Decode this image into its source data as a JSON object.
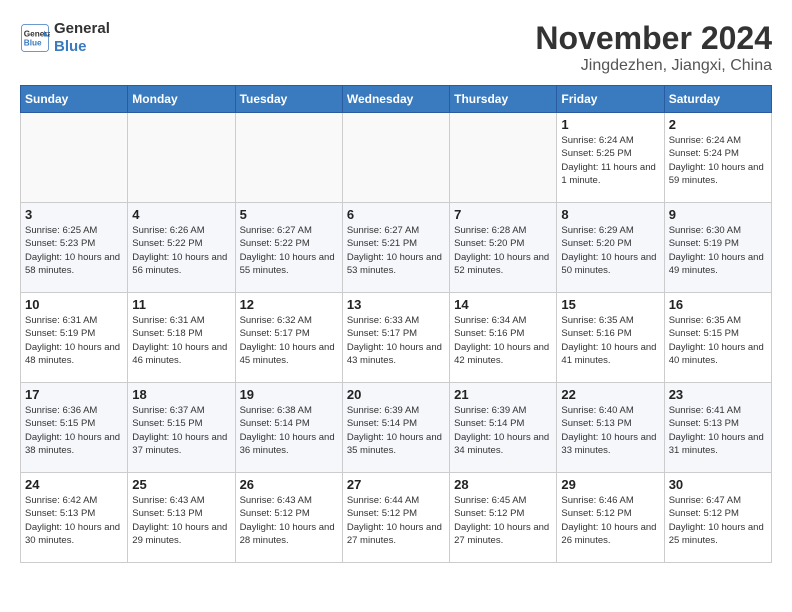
{
  "logo": {
    "line1": "General",
    "line2": "Blue"
  },
  "title": "November 2024",
  "subtitle": "Jingdezhen, Jiangxi, China",
  "headers": [
    "Sunday",
    "Monday",
    "Tuesday",
    "Wednesday",
    "Thursday",
    "Friday",
    "Saturday"
  ],
  "weeks": [
    [
      {
        "day": "",
        "info": ""
      },
      {
        "day": "",
        "info": ""
      },
      {
        "day": "",
        "info": ""
      },
      {
        "day": "",
        "info": ""
      },
      {
        "day": "",
        "info": ""
      },
      {
        "day": "1",
        "info": "Sunrise: 6:24 AM\nSunset: 5:25 PM\nDaylight: 11 hours and 1 minute."
      },
      {
        "day": "2",
        "info": "Sunrise: 6:24 AM\nSunset: 5:24 PM\nDaylight: 10 hours and 59 minutes."
      }
    ],
    [
      {
        "day": "3",
        "info": "Sunrise: 6:25 AM\nSunset: 5:23 PM\nDaylight: 10 hours and 58 minutes."
      },
      {
        "day": "4",
        "info": "Sunrise: 6:26 AM\nSunset: 5:22 PM\nDaylight: 10 hours and 56 minutes."
      },
      {
        "day": "5",
        "info": "Sunrise: 6:27 AM\nSunset: 5:22 PM\nDaylight: 10 hours and 55 minutes."
      },
      {
        "day": "6",
        "info": "Sunrise: 6:27 AM\nSunset: 5:21 PM\nDaylight: 10 hours and 53 minutes."
      },
      {
        "day": "7",
        "info": "Sunrise: 6:28 AM\nSunset: 5:20 PM\nDaylight: 10 hours and 52 minutes."
      },
      {
        "day": "8",
        "info": "Sunrise: 6:29 AM\nSunset: 5:20 PM\nDaylight: 10 hours and 50 minutes."
      },
      {
        "day": "9",
        "info": "Sunrise: 6:30 AM\nSunset: 5:19 PM\nDaylight: 10 hours and 49 minutes."
      }
    ],
    [
      {
        "day": "10",
        "info": "Sunrise: 6:31 AM\nSunset: 5:19 PM\nDaylight: 10 hours and 48 minutes."
      },
      {
        "day": "11",
        "info": "Sunrise: 6:31 AM\nSunset: 5:18 PM\nDaylight: 10 hours and 46 minutes."
      },
      {
        "day": "12",
        "info": "Sunrise: 6:32 AM\nSunset: 5:17 PM\nDaylight: 10 hours and 45 minutes."
      },
      {
        "day": "13",
        "info": "Sunrise: 6:33 AM\nSunset: 5:17 PM\nDaylight: 10 hours and 43 minutes."
      },
      {
        "day": "14",
        "info": "Sunrise: 6:34 AM\nSunset: 5:16 PM\nDaylight: 10 hours and 42 minutes."
      },
      {
        "day": "15",
        "info": "Sunrise: 6:35 AM\nSunset: 5:16 PM\nDaylight: 10 hours and 41 minutes."
      },
      {
        "day": "16",
        "info": "Sunrise: 6:35 AM\nSunset: 5:15 PM\nDaylight: 10 hours and 40 minutes."
      }
    ],
    [
      {
        "day": "17",
        "info": "Sunrise: 6:36 AM\nSunset: 5:15 PM\nDaylight: 10 hours and 38 minutes."
      },
      {
        "day": "18",
        "info": "Sunrise: 6:37 AM\nSunset: 5:15 PM\nDaylight: 10 hours and 37 minutes."
      },
      {
        "day": "19",
        "info": "Sunrise: 6:38 AM\nSunset: 5:14 PM\nDaylight: 10 hours and 36 minutes."
      },
      {
        "day": "20",
        "info": "Sunrise: 6:39 AM\nSunset: 5:14 PM\nDaylight: 10 hours and 35 minutes."
      },
      {
        "day": "21",
        "info": "Sunrise: 6:39 AM\nSunset: 5:14 PM\nDaylight: 10 hours and 34 minutes."
      },
      {
        "day": "22",
        "info": "Sunrise: 6:40 AM\nSunset: 5:13 PM\nDaylight: 10 hours and 33 minutes."
      },
      {
        "day": "23",
        "info": "Sunrise: 6:41 AM\nSunset: 5:13 PM\nDaylight: 10 hours and 31 minutes."
      }
    ],
    [
      {
        "day": "24",
        "info": "Sunrise: 6:42 AM\nSunset: 5:13 PM\nDaylight: 10 hours and 30 minutes."
      },
      {
        "day": "25",
        "info": "Sunrise: 6:43 AM\nSunset: 5:13 PM\nDaylight: 10 hours and 29 minutes."
      },
      {
        "day": "26",
        "info": "Sunrise: 6:43 AM\nSunset: 5:12 PM\nDaylight: 10 hours and 28 minutes."
      },
      {
        "day": "27",
        "info": "Sunrise: 6:44 AM\nSunset: 5:12 PM\nDaylight: 10 hours and 27 minutes."
      },
      {
        "day": "28",
        "info": "Sunrise: 6:45 AM\nSunset: 5:12 PM\nDaylight: 10 hours and 27 minutes."
      },
      {
        "day": "29",
        "info": "Sunrise: 6:46 AM\nSunset: 5:12 PM\nDaylight: 10 hours and 26 minutes."
      },
      {
        "day": "30",
        "info": "Sunrise: 6:47 AM\nSunset: 5:12 PM\nDaylight: 10 hours and 25 minutes."
      }
    ]
  ]
}
